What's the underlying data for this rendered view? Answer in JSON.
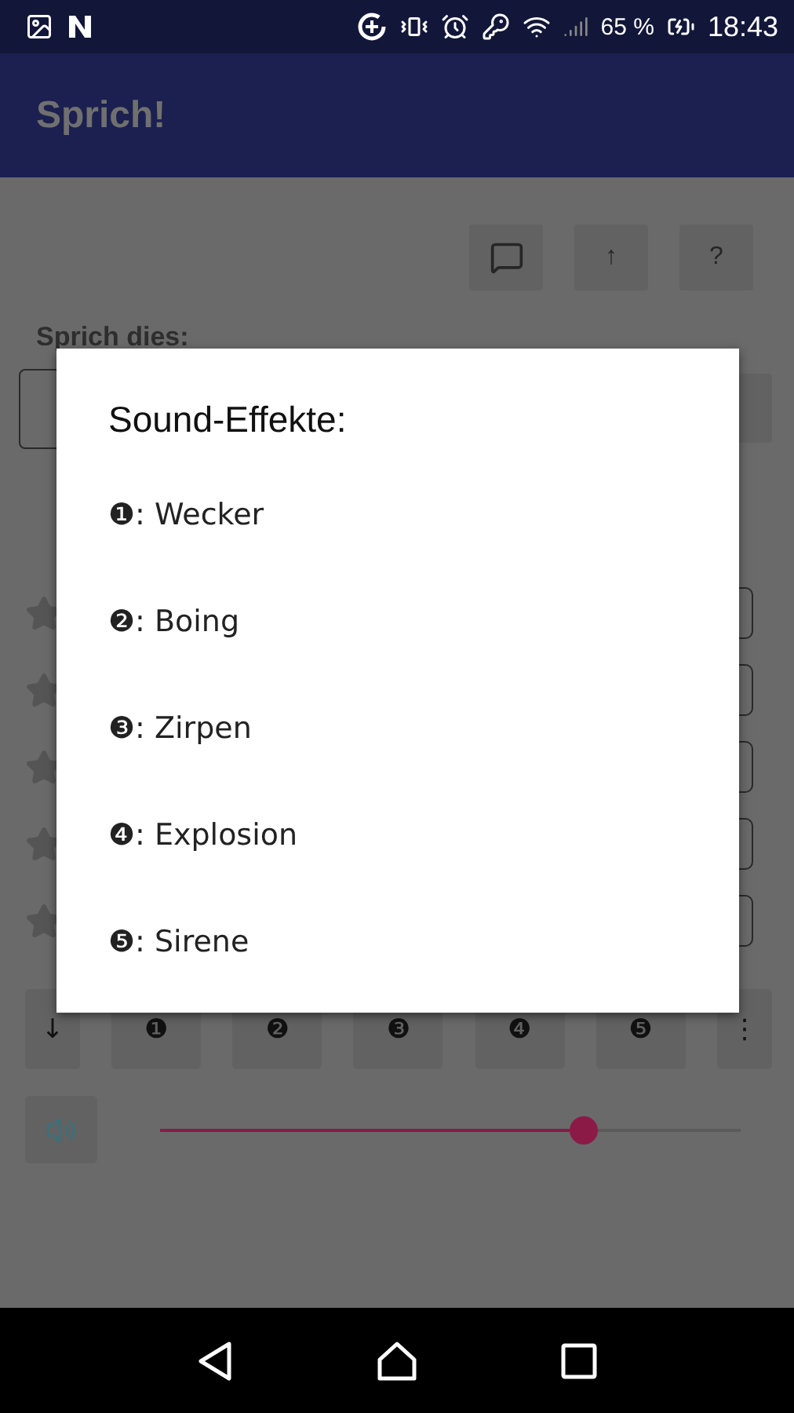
{
  "status_bar": {
    "battery": "65 %",
    "time": "18:43"
  },
  "app_bar": {
    "title": "Sprich!"
  },
  "toolbar": [
    {
      "kind": "speech"
    },
    {
      "kind": "text",
      "label": "↑"
    },
    {
      "kind": "text",
      "label": "?"
    }
  ],
  "prompt_label": "Sprich dies:",
  "sound_buttons": [
    {
      "label": "↓",
      "kind": "narrow"
    },
    {
      "label": "❶",
      "kind": "wide"
    },
    {
      "label": "❷",
      "kind": "wide"
    },
    {
      "label": "❸",
      "kind": "wide"
    },
    {
      "label": "❹",
      "kind": "wide"
    },
    {
      "label": "❺",
      "kind": "wide"
    },
    {
      "label": "⋮",
      "kind": "narrow"
    }
  ],
  "volume": {
    "level": 0.73
  },
  "dialog": {
    "title": "Sound-Effekte:",
    "items": [
      "❶: Wecker",
      "❷: Boing",
      "❸: Zirpen",
      "❹: Explosion",
      "❺: Sirene"
    ]
  }
}
